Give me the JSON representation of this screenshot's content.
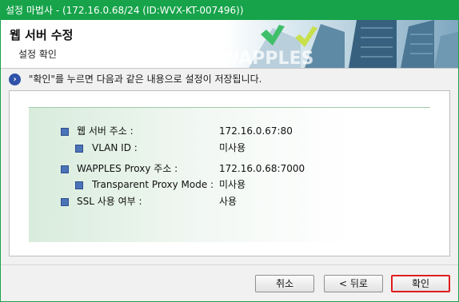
{
  "window": {
    "title": "설정 마법사 - (172.16.0.68/24 (ID:WVX-KT-007496))"
  },
  "header": {
    "title": "웹 서버 수정",
    "subtitle": "설정 확인",
    "logo_text": "WAPPLES"
  },
  "instruction": {
    "icon": "info-arrow-icon",
    "text": "\"확인\"를 누르면 다음과 같은 내용으로 설정이 저장됩니다."
  },
  "summary": {
    "web_server_address": {
      "label": "웹 서버 주소 :",
      "value": "172.16.0.67:80"
    },
    "vlan_id": {
      "label": "VLAN ID :",
      "value": "미사용"
    },
    "proxy_address": {
      "label": "WAPPLES  Proxy 주소 :",
      "value": "172.16.0.68:7000"
    },
    "transparent_proxy": {
      "label": "Transparent Proxy Mode :",
      "value": "미사용"
    },
    "ssl_usage": {
      "label": "SSL 사용 여부 :",
      "value": "사용"
    }
  },
  "buttons": {
    "cancel": "취소",
    "back": "< 뒤로",
    "ok": "확인"
  },
  "colors": {
    "titlebar": "#16a34a",
    "bullet": "#4a73b8",
    "ok_highlight": "#e01e1e"
  }
}
